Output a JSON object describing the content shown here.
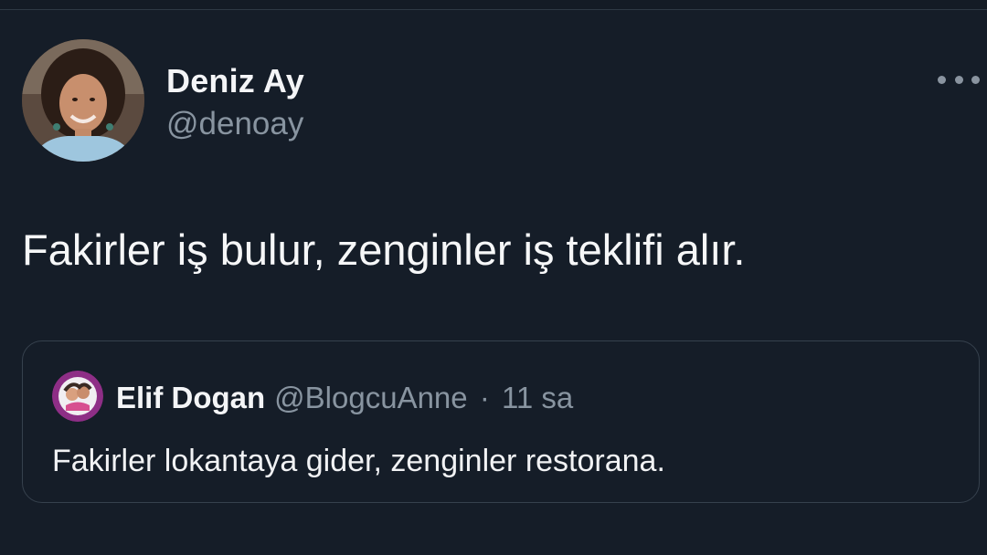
{
  "tweet": {
    "author": {
      "name": "Deniz Ay",
      "handle": "@denoay"
    },
    "text": "Fakirler iş bulur, zenginler iş teklifi alır.",
    "more_icon": "more-horizontal-icon"
  },
  "quoted_tweet": {
    "author": {
      "name": "Elif Dogan",
      "handle": "@BlogcuAnne"
    },
    "separator": "·",
    "time": "11 sa",
    "text": "Fakirler lokantaya gider, zenginler restorana."
  },
  "colors": {
    "background": "#151d28",
    "border": "#36414d",
    "secondary_text": "#8894a0",
    "primary_text": "#f4f5f7"
  }
}
